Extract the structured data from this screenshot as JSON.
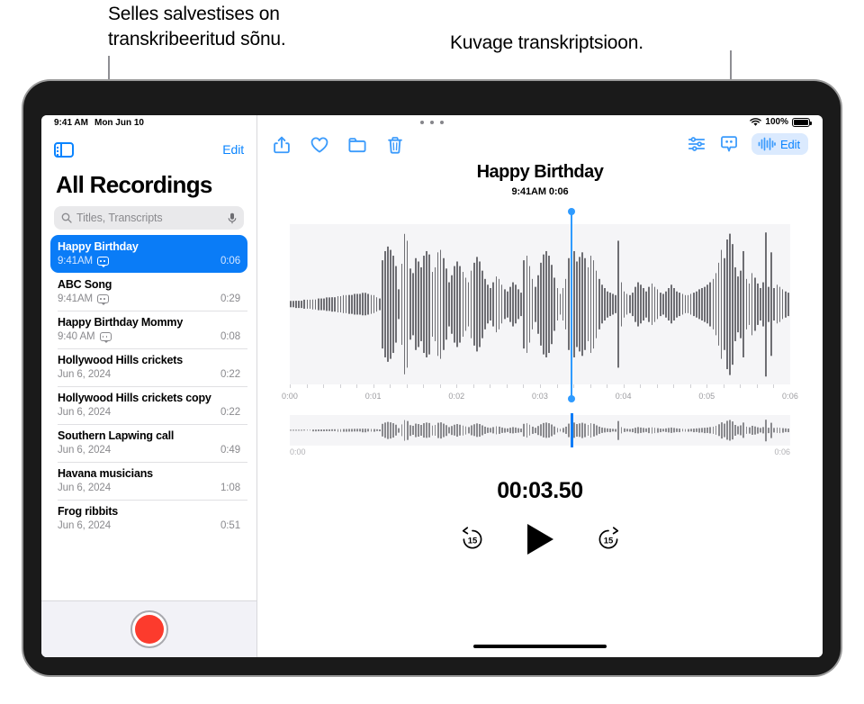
{
  "annotations": {
    "callout_1": "Selles salvestises on transkribeeritud sõnu.",
    "callout_2": "Kuvage transkriptsioon."
  },
  "statusbar": {
    "time": "9:41 AM",
    "date": "Mon Jun 10",
    "battery_percent": "100%",
    "wifi_icon": "wifi-icon",
    "battery_icon": "battery-icon"
  },
  "sidebar": {
    "toggle_icon": "sidebar-toggle-icon",
    "edit_label": "Edit",
    "title": "All Recordings",
    "search": {
      "placeholder": "Titles, Transcripts",
      "search_icon": "search-icon",
      "mic_icon": "microphone-icon"
    },
    "recordings": [
      {
        "title": "Happy Birthday",
        "meta": "9:41AM",
        "duration": "0:06",
        "has_transcript": true,
        "selected": true
      },
      {
        "title": "ABC Song",
        "meta": "9:41AM",
        "duration": "0:29",
        "has_transcript": true,
        "selected": false
      },
      {
        "title": "Happy Birthday Mommy",
        "meta": "9:40 AM",
        "duration": "0:08",
        "has_transcript": true,
        "selected": false
      },
      {
        "title": "Hollywood Hills crickets",
        "meta": "Jun 6, 2024",
        "duration": "0:22",
        "has_transcript": false,
        "selected": false
      },
      {
        "title": "Hollywood Hills crickets copy",
        "meta": "Jun 6, 2024",
        "duration": "0:22",
        "has_transcript": false,
        "selected": false
      },
      {
        "title": "Southern Lapwing call",
        "meta": "Jun 6, 2024",
        "duration": "0:49",
        "has_transcript": false,
        "selected": false
      },
      {
        "title": "Havana musicians",
        "meta": "Jun 6, 2024",
        "duration": "1:08",
        "has_transcript": false,
        "selected": false
      },
      {
        "title": "Frog ribbits",
        "meta": "Jun 6, 2024",
        "duration": "0:51",
        "has_transcript": false,
        "selected": false
      }
    ],
    "record_button": "record-button"
  },
  "detail": {
    "toolbar": {
      "share_icon": "share-icon",
      "favorite_icon": "heart-icon",
      "folder_icon": "folder-icon",
      "delete_icon": "trash-icon",
      "settings_icon": "audio-settings-icon",
      "transcript_icon": "transcript-bubble-icon",
      "edit_label": "Edit",
      "edit_waveform_icon": "waveform-icon"
    },
    "title": "Happy Birthday",
    "subtitle": "9:41AM  0:06",
    "current_time": "00:03.50",
    "transport": {
      "skip_back_label": "15",
      "skip_forward_label": "15",
      "play_icon": "play-icon"
    },
    "mini_timeline": {
      "start": "0:00",
      "end": "0:06"
    }
  },
  "chart_data": {
    "type": "area",
    "title": "Happy Birthday audio waveform",
    "xlabel": "",
    "ylabel": "",
    "axis_ticks": [
      "0:00",
      "0:01",
      "0:02",
      "0:03",
      "0:04",
      "0:05",
      "0:06"
    ],
    "duration_seconds": 6,
    "playhead_seconds": 3.5,
    "playhead_fraction": 0.563,
    "amplitudes": [
      0.04,
      0.04,
      0.05,
      0.05,
      0.05,
      0.06,
      0.06,
      0.06,
      0.07,
      0.07,
      0.08,
      0.08,
      0.08,
      0.09,
      0.09,
      0.1,
      0.1,
      0.11,
      0.11,
      0.12,
      0.12,
      0.13,
      0.13,
      0.14,
      0.14,
      0.14,
      0.15,
      0.15,
      0.14,
      0.13,
      0.12,
      0.1,
      0.08,
      0.6,
      0.72,
      0.78,
      0.74,
      0.66,
      0.52,
      0.2,
      0.55,
      0.95,
      0.86,
      0.48,
      0.42,
      0.62,
      0.58,
      0.5,
      0.66,
      0.72,
      0.68,
      0.44,
      0.5,
      0.7,
      0.74,
      0.62,
      0.48,
      0.3,
      0.4,
      0.52,
      0.58,
      0.52,
      0.44,
      0.36,
      0.3,
      0.46,
      0.56,
      0.64,
      0.58,
      0.46,
      0.34,
      0.26,
      0.22,
      0.3,
      0.38,
      0.34,
      0.26,
      0.2,
      0.18,
      0.24,
      0.3,
      0.26,
      0.2,
      0.16,
      0.6,
      0.66,
      0.52,
      0.34,
      0.24,
      0.4,
      0.56,
      0.68,
      0.72,
      0.66,
      0.54,
      0.36,
      0.22,
      0.14,
      0.22,
      0.34,
      0.62,
      0.78,
      0.72,
      0.58,
      0.64,
      0.7,
      0.62,
      0.5,
      0.66,
      0.6,
      0.46,
      0.34,
      0.26,
      0.22,
      0.18,
      0.16,
      0.14,
      0.12,
      0.86,
      0.3,
      0.18,
      0.14,
      0.12,
      0.16,
      0.24,
      0.3,
      0.26,
      0.22,
      0.18,
      0.24,
      0.28,
      0.24,
      0.2,
      0.16,
      0.14,
      0.18,
      0.22,
      0.26,
      0.22,
      0.18,
      0.16,
      0.14,
      0.12,
      0.12,
      0.14,
      0.16,
      0.18,
      0.2,
      0.22,
      0.24,
      0.26,
      0.3,
      0.34,
      0.42,
      0.56,
      0.74,
      0.62,
      0.88,
      0.96,
      0.82,
      0.5,
      0.38,
      0.46,
      0.72,
      0.34,
      0.28,
      0.42,
      0.36,
      0.28,
      0.22,
      0.3,
      0.98,
      0.24,
      0.7,
      0.22,
      0.26,
      0.24,
      0.2,
      0.18,
      0.16
    ]
  }
}
